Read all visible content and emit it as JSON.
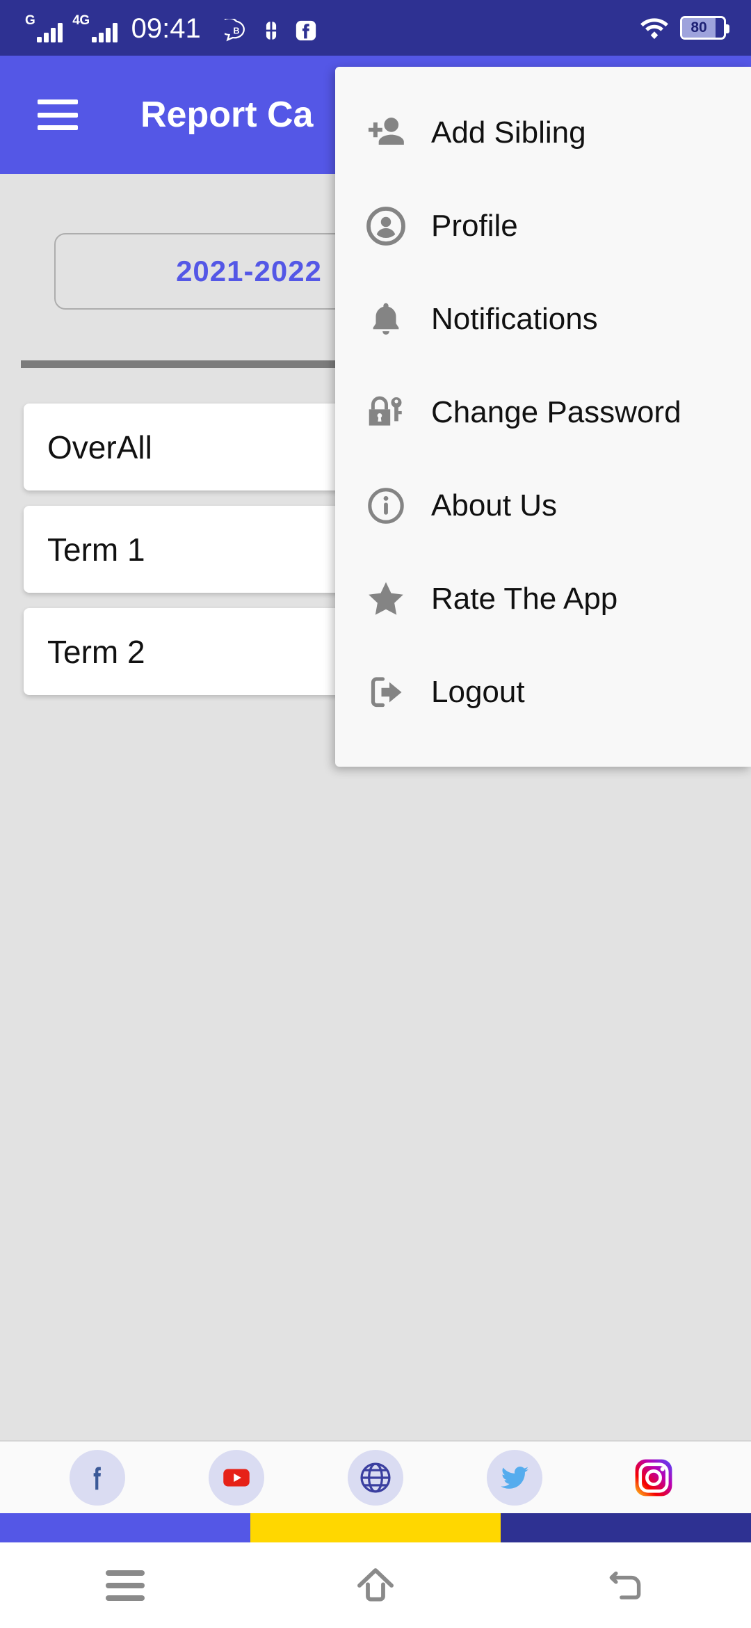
{
  "status_bar": {
    "signal_1_label": "G",
    "signal_2_label": "4G",
    "time": "09:41",
    "battery_level": "80",
    "icons": [
      "signal-g-icon",
      "signal-4g-icon",
      "btalk-icon",
      "clover-app-icon",
      "facebook-app-icon",
      "wifi-icon",
      "battery-icon"
    ],
    "colors": {
      "background": "#2E3192"
    }
  },
  "app_bar": {
    "menu_icon": "hamburger-icon",
    "title": "Report Ca",
    "title_full": "Report Card",
    "colors": {
      "background": "#5457E6",
      "text": "#FFFFFF"
    }
  },
  "main": {
    "year_select": {
      "value": "2021-2022",
      "caret_icon": "chevron-down-icon",
      "color": "#5457E6"
    },
    "terms": [
      {
        "label": "OverAll"
      },
      {
        "label": "Term 1"
      },
      {
        "label": "Term 2"
      }
    ]
  },
  "overflow_menu": {
    "items": [
      {
        "label": "Add Sibling",
        "icon": "person-add-icon"
      },
      {
        "label": "Profile",
        "icon": "account-circle-icon"
      },
      {
        "label": "Notifications",
        "icon": "bell-icon"
      },
      {
        "label": "Change Password",
        "icon": "lock-key-icon"
      },
      {
        "label": "About Us",
        "icon": "info-circle-icon"
      },
      {
        "label": "Rate The App",
        "icon": "star-icon"
      },
      {
        "label": "Logout",
        "icon": "logout-icon"
      }
    ],
    "colors": {
      "background": "#F8F8F8",
      "icon": "#848484",
      "text": "#111111"
    }
  },
  "social_bar": {
    "items": [
      {
        "name": "facebook",
        "icon": "facebook-icon",
        "color": "#3B5998"
      },
      {
        "name": "youtube",
        "icon": "youtube-icon",
        "color": "#E62117"
      },
      {
        "name": "website",
        "icon": "globe-icon",
        "color": "#3B3FA0"
      },
      {
        "name": "twitter",
        "icon": "twitter-icon",
        "color": "#55ACEE"
      },
      {
        "name": "instagram",
        "icon": "instagram-icon",
        "color": "#C13584"
      }
    ],
    "bubble_color": "#DADCF2"
  },
  "color_bands": [
    {
      "name": "band-indigo",
      "color": "#5457E6"
    },
    {
      "name": "band-yellow",
      "color": "#FFD700"
    },
    {
      "name": "band-navy",
      "color": "#2E3192"
    }
  ],
  "nav_bar": {
    "recents_icon": "recents-icon",
    "home_icon": "home-icon",
    "back_icon": "back-icon",
    "icon_color": "#8A8A8A"
  }
}
